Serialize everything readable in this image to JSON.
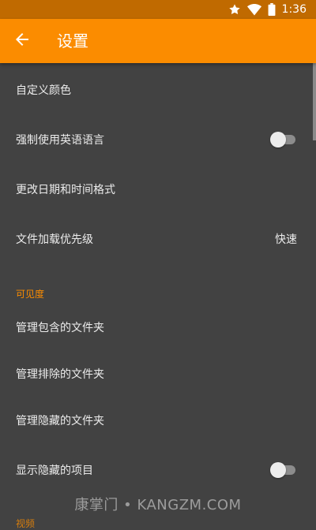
{
  "status_bar": {
    "time": "1:36",
    "icons": [
      "star-icon",
      "wifi-icon",
      "battery-icon"
    ]
  },
  "app_bar": {
    "title": "设置",
    "back_icon": "arrow-left-icon"
  },
  "settings": {
    "custom_colors": "自定义颜色",
    "force_english": "强制使用英语语言",
    "force_english_on": false,
    "date_time_format": "更改日期和时间格式",
    "file_loading_priority": "文件加载优先级",
    "file_loading_priority_value": "快速"
  },
  "visibility": {
    "header": "可见度",
    "included_folders": "管理包含的文件夹",
    "excluded_folders": "管理排除的文件夹",
    "hidden_folders": "管理隐藏的文件夹",
    "show_hidden_items": "显示隐藏的项目",
    "show_hidden_items_on": false
  },
  "next_section": {
    "header": "视频"
  },
  "watermark": "康掌门 • KANGZM.COM",
  "colors": {
    "accent": "#fb8c00",
    "status_bar": "#c06a00",
    "background": "#424242"
  }
}
